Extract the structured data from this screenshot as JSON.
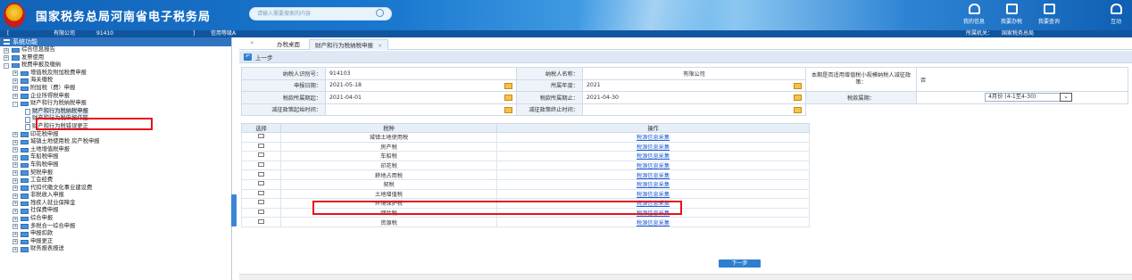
{
  "header": {
    "title": "国家税务总局河南省电子税务局",
    "search_placeholder": "请输入需要搜索的内容",
    "nav": [
      {
        "label": "我的信息",
        "icon": "person-icon"
      },
      {
        "label": "我要办税",
        "icon": "monitor-icon"
      },
      {
        "label": "我要查询",
        "icon": "search-doc-icon"
      },
      {
        "label": "互动",
        "icon": "chat-icon"
      }
    ]
  },
  "infobar": {
    "open_bracket": "[",
    "company": "有限公司",
    "tax_id": "91410",
    "close_bracket": "]",
    "credit": "信用等级A",
    "authority_label": "所属机关：",
    "authority_value": "国家税务总局"
  },
  "sidebar": {
    "title": "系统功能",
    "items": [
      {
        "label": "综合信息报告",
        "level": 0,
        "expand": "+",
        "type": "folder"
      },
      {
        "label": "发票使用",
        "level": 0,
        "expand": "+",
        "type": "folder"
      },
      {
        "label": "税费申报及缴纳",
        "level": 0,
        "expand": "-",
        "type": "folder"
      },
      {
        "label": "增值税及附加税费申报",
        "level": 1,
        "expand": "+",
        "type": "folder"
      },
      {
        "label": "海关缴税",
        "level": 1,
        "expand": "+",
        "type": "folder"
      },
      {
        "label": "附加税（费）申报",
        "level": 1,
        "expand": "+",
        "type": "folder"
      },
      {
        "label": "企业所得税申报",
        "level": 1,
        "expand": "+",
        "type": "folder"
      },
      {
        "label": "财产和行为税纳税申报",
        "level": 1,
        "expand": "-",
        "type": "folder"
      },
      {
        "label": "财产和行为税纳税申报",
        "level": 2,
        "expand": "",
        "type": "file",
        "selected": true
      },
      {
        "label": "财产和行为税申报作废",
        "level": 2,
        "expand": "",
        "type": "file"
      },
      {
        "label": "财产和行为税错误更正",
        "level": 2,
        "expand": "",
        "type": "file"
      },
      {
        "label": "印花税申报",
        "level": 1,
        "expand": "+",
        "type": "folder"
      },
      {
        "label": "城镇土地使用税 房产税申报",
        "level": 1,
        "expand": "+",
        "type": "folder"
      },
      {
        "label": "土地增值税申报",
        "level": 1,
        "expand": "+",
        "type": "folder"
      },
      {
        "label": "车船税申报",
        "level": 1,
        "expand": "+",
        "type": "folder"
      },
      {
        "label": "车购税申报",
        "level": 1,
        "expand": "+",
        "type": "folder"
      },
      {
        "label": "契税申报",
        "level": 1,
        "expand": "+",
        "type": "folder"
      },
      {
        "label": "工会经费",
        "level": 1,
        "expand": "+",
        "type": "folder"
      },
      {
        "label": "代扣代缴文化事业建设费",
        "level": 1,
        "expand": "+",
        "type": "folder"
      },
      {
        "label": "非税收入申报",
        "level": 1,
        "expand": "+",
        "type": "folder"
      },
      {
        "label": "残疾人就业保障金",
        "level": 1,
        "expand": "+",
        "type": "folder"
      },
      {
        "label": "社保费申报",
        "level": 1,
        "expand": "+",
        "type": "folder"
      },
      {
        "label": "综合申报",
        "level": 1,
        "expand": "+",
        "type": "folder"
      },
      {
        "label": "多税合一综合申报",
        "level": 1,
        "expand": "+",
        "type": "folder"
      },
      {
        "label": "申报扣款",
        "level": 1,
        "expand": "+",
        "type": "folder"
      },
      {
        "label": "申报更正",
        "level": 1,
        "expand": "+",
        "type": "folder"
      },
      {
        "label": "财务报表报送",
        "level": 1,
        "expand": "+",
        "type": "folder"
      }
    ]
  },
  "tabs": {
    "arrow": "«",
    "items": [
      {
        "label": "办税桌面",
        "active": false,
        "close": ""
      },
      {
        "label": "财产和行为税纳税申报",
        "active": true,
        "close": "×"
      }
    ]
  },
  "backbar": {
    "label": "上一步",
    "icon": "back-arrow-icon"
  },
  "form": {
    "taxpayer_id_label": "纳税人识别号：",
    "taxpayer_id": "914103",
    "taxpayer_name_label": "纳税人名称：",
    "taxpayer_name": "有限公司",
    "small_scale_label": "本期是否适用增值税小规模纳税人减征政策：",
    "small_scale_value": "否",
    "filing_date_label": "申报日期：",
    "filing_date": "2021-05-18",
    "year_label": "所属年度：",
    "year": "2021",
    "period_start_label": "税款所属期起：",
    "period_start": "2021-04-01",
    "period_end_label": "税款所属期止：",
    "period_end": "2021-04-30",
    "tax_period_label": "税款属期：",
    "tax_period": "4月份 (4-1至4-30)",
    "policy_start_label": "减征政策起始时间：",
    "policy_start": "",
    "policy_end_label": "减征政策终止时间：",
    "policy_end": ""
  },
  "grid": {
    "headers": [
      "选择",
      "税种",
      "操作"
    ],
    "action_label": "税源信息采集",
    "rows": [
      {
        "tax": "城镇土地使用税"
      },
      {
        "tax": "房产税"
      },
      {
        "tax": "车船税"
      },
      {
        "tax": "印花税"
      },
      {
        "tax": "耕地占用税"
      },
      {
        "tax": "契税"
      },
      {
        "tax": "土地增值税"
      },
      {
        "tax": "环境保护税"
      },
      {
        "tax": "烟叶税"
      },
      {
        "tax": "资源税"
      }
    ]
  },
  "next_button": "下一步",
  "colors": {
    "header_blue": "#1a78cf",
    "highlight_red": "#e6141b",
    "link_blue": "#1f5bd1"
  }
}
